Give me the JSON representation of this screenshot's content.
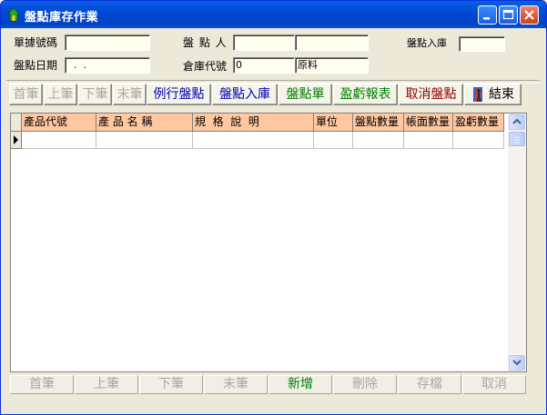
{
  "window": {
    "title": "盤點庫存作業"
  },
  "form": {
    "doc_no_label": "單據號碼",
    "doc_no_value": "",
    "counter_label": "盤 點 人",
    "counter_code": "",
    "counter_name": "",
    "stock_in_label": "盤點入庫",
    "stock_in_value": "",
    "date_label": "盤點日期",
    "date_value": "  .  .",
    "warehouse_label": "倉庫代號",
    "warehouse_code": "0",
    "warehouse_name": "原料"
  },
  "toolbar": {
    "first": "首筆",
    "prev": "上筆",
    "next": "下筆",
    "last": "末筆",
    "routine": "例行盤點",
    "stock_in": "盤點入庫",
    "sheet": "盤點單",
    "report": "盈虧報表",
    "cancel": "取消盤點",
    "exit": "結束"
  },
  "grid": {
    "columns": [
      "產品代號",
      "產 品 名 稱",
      "規  格  說  明",
      "單位",
      "盤點數量",
      "帳面數量",
      "盈虧數量"
    ]
  },
  "bottom": {
    "first": "首筆",
    "prev": "上筆",
    "next": "下筆",
    "last": "末筆",
    "add": "新增",
    "delete": "刪除",
    "save": "存檔",
    "cancel": "取消"
  },
  "colors": {
    "titlebar": "#0049d6",
    "grid_header": "#ffc8a0",
    "input_bg": "#fffff0"
  }
}
